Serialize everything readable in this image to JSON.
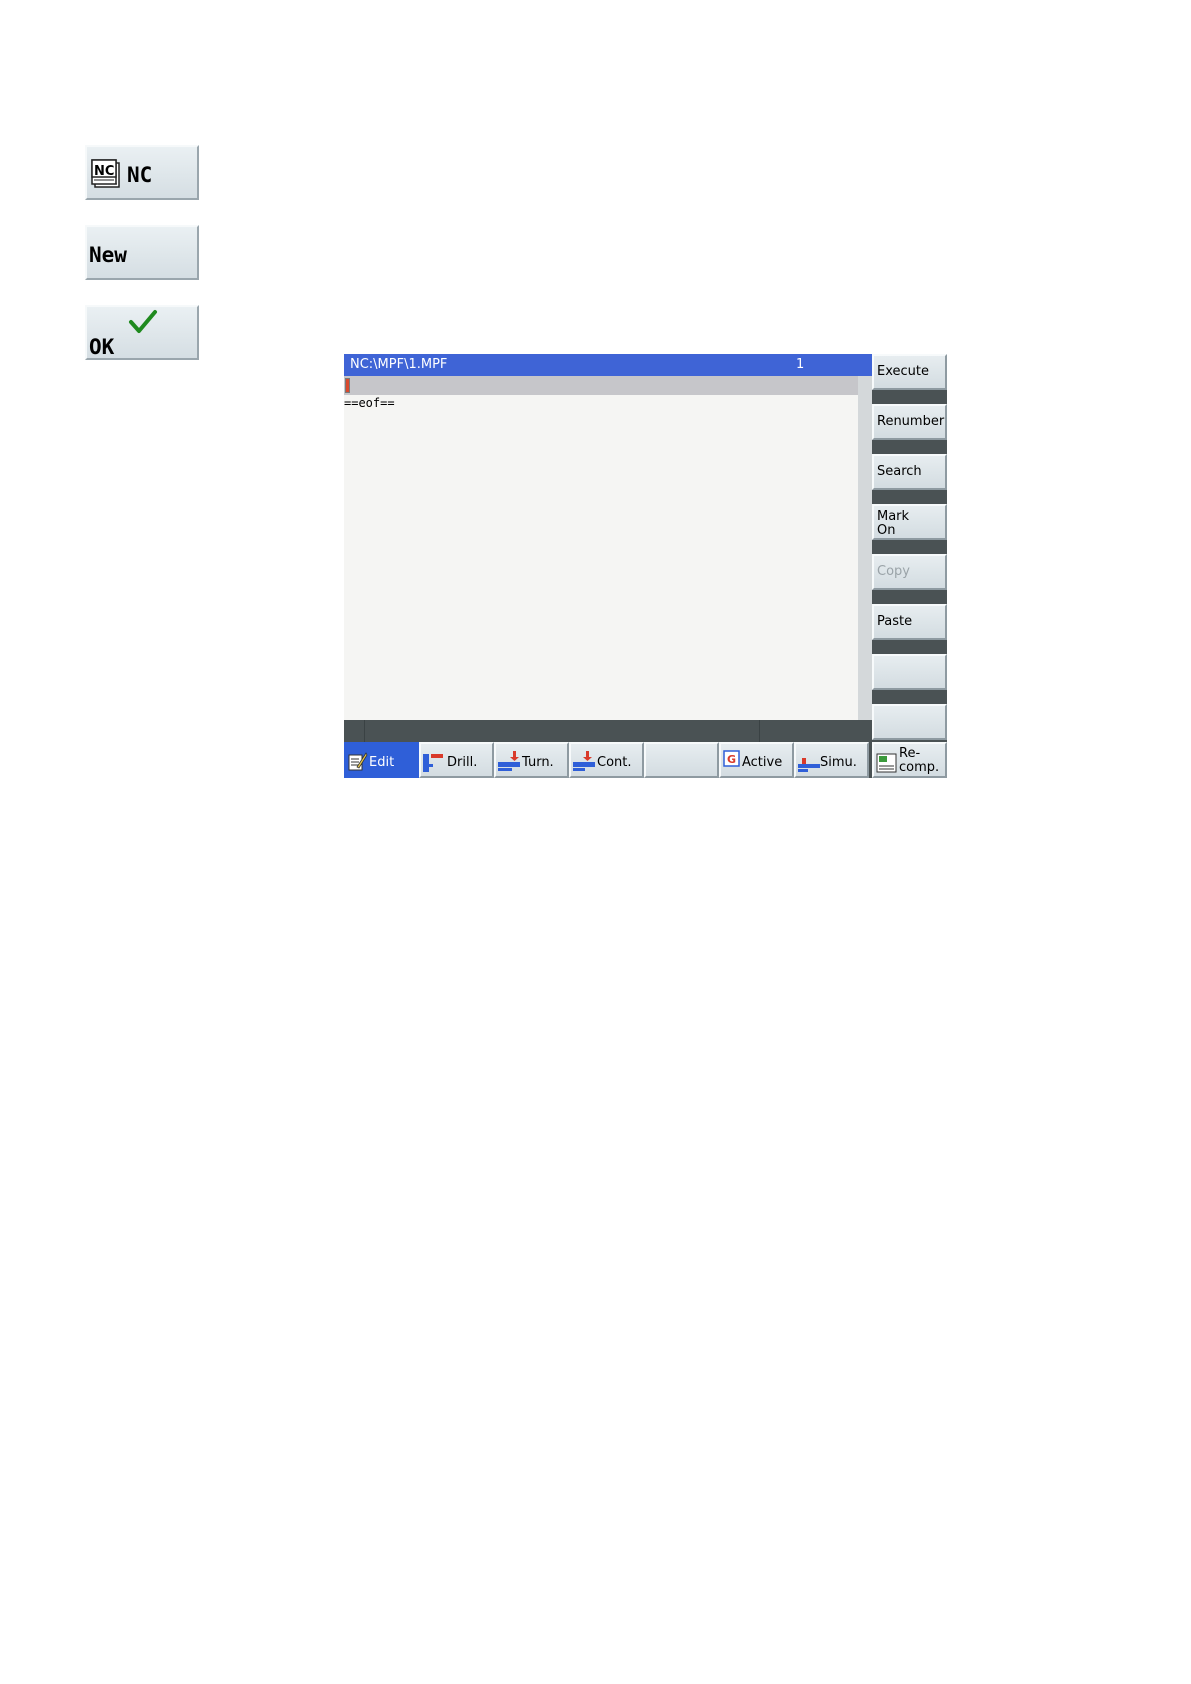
{
  "keys": {
    "nc": {
      "label": "NC",
      "icon": "nc-directory-icon"
    },
    "new": {
      "label": "New"
    },
    "ok": {
      "label": "OK",
      "icon": "checkmark-icon",
      "icon_color": "#1f8a1f"
    }
  },
  "editor": {
    "file_path": "NC:\\MPF\\1.MPF",
    "line_number": "1",
    "eof_text": "==eof=="
  },
  "vertical_softkeys": [
    {
      "label": "Execute",
      "enabled": true
    },
    {
      "label": "Renumber",
      "enabled": true
    },
    {
      "label": "Search",
      "enabled": true
    },
    {
      "label": "Mark\nOn",
      "enabled": true
    },
    {
      "label": "Copy",
      "enabled": false
    },
    {
      "label": "Paste",
      "enabled": true
    },
    {
      "label": "",
      "enabled": true
    },
    {
      "label": "",
      "enabled": true
    }
  ],
  "horizontal_softkeys": [
    {
      "label": "Edit",
      "icon": "edit-icon",
      "active": true
    },
    {
      "label": "Drill.",
      "icon": "drill-icon",
      "active": false
    },
    {
      "label": "Turn.",
      "icon": "turning-icon",
      "active": false
    },
    {
      "label": "Cont.",
      "icon": "contour-icon",
      "active": false
    },
    {
      "label": "",
      "icon": "",
      "active": false
    },
    {
      "label": "Active",
      "icon": "g-code-icon",
      "active": false
    },
    {
      "label": "Simu.",
      "icon": "simulation-icon",
      "active": false
    },
    {
      "label": "Re-\ncomp.",
      "icon": "recompile-icon",
      "active": false
    }
  ],
  "colors": {
    "title_bar": "#3f64d6",
    "active_softkey": "#2f5fd8"
  }
}
